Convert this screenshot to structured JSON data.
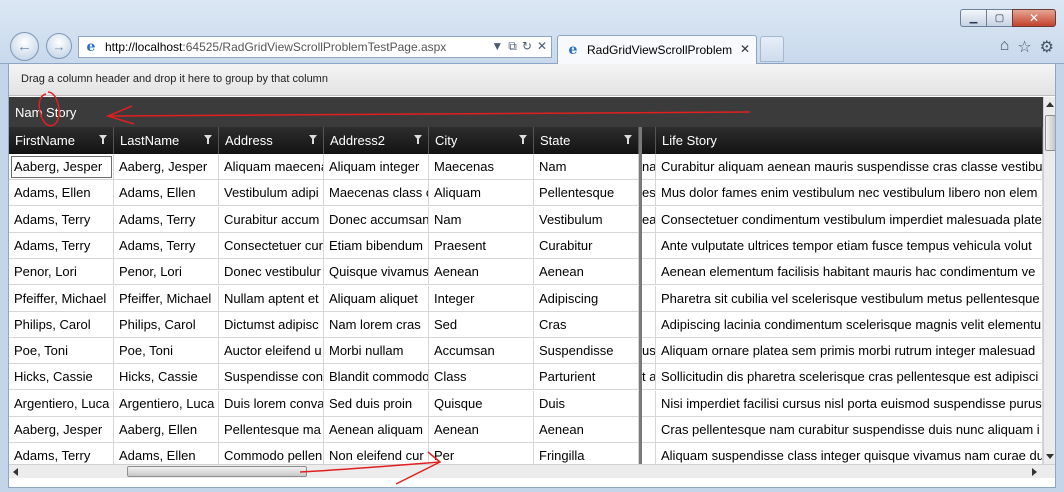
{
  "browser": {
    "url_host": "http://localhost",
    "url_rest": ":64525/RadGridViewScrollProblemTestPage.aspx",
    "tab_title": "RadGridViewScrollProblem",
    "tab_close_glyph": "✕",
    "back_glyph": "←",
    "forward_glyph": "→",
    "window_buttons": {
      "minimize": "▁",
      "maximize": "▢",
      "close": "✕"
    },
    "address_tools": {
      "dropdown": "▼",
      "compat": "⧉",
      "refresh": "↻",
      "stop": "✕"
    },
    "right_tools": {
      "home": "⌂",
      "favorites": "☆",
      "tools": "⚙"
    }
  },
  "grid": {
    "group_panel_text": "Drag a column header and drop it here to group by that column",
    "title": "Nam  Story",
    "columns": [
      {
        "key": "first",
        "label": "FirstName",
        "filter": true
      },
      {
        "key": "last",
        "label": "LastName",
        "filter": true
      },
      {
        "key": "address",
        "label": "Address",
        "filter": true
      },
      {
        "key": "address2",
        "label": "Address2",
        "filter": true
      },
      {
        "key": "city",
        "label": "City",
        "filter": true
      },
      {
        "key": "state",
        "label": "State",
        "filter": true
      },
      {
        "key": "life",
        "label": "Life Story",
        "filter": false
      }
    ],
    "rows": [
      {
        "first": "Aaberg, Jesper",
        "last": "Aaberg, Jesper",
        "address": "Aliquam maecena",
        "address2": "Aliquam integer",
        "city": "Maecenas",
        "state": "Nam",
        "hidden": "na",
        "life": "Curabitur aliquam aenean mauris suspendisse cras classe vestibulu"
      },
      {
        "first": "Adams, Ellen",
        "last": "Adams, Ellen",
        "address": "Vestibulum adipi",
        "address2": "Maecenas class c",
        "city": "Aliquam",
        "state": "Pellentesque",
        "hidden": "ese",
        "life": "Mus dolor fames enim vestibulum nec vestibulum libero non elem"
      },
      {
        "first": "Adams, Terry",
        "last": "Adams, Terry",
        "address": "Curabitur accum",
        "address2": "Donec accumsan",
        "city": "Nam",
        "state": "Vestibulum",
        "hidden": "ear",
        "life": "Consectetuer condimentum vestibulum imperdiet malesuada plate"
      },
      {
        "first": "Adams, Terry",
        "last": "Adams, Terry",
        "address": "Consectetuer cur",
        "address2": "Etiam bibendum",
        "city": "Praesent",
        "state": "Curabitur",
        "hidden": "",
        "life": "Ante vulputate ultrices tempor etiam fusce tempus vehicula volut"
      },
      {
        "first": "Penor, Lori",
        "last": "Penor, Lori",
        "address": "Donec vestibulur",
        "address2": "Quisque vivamus",
        "city": "Aenean",
        "state": "Aenean",
        "hidden": "",
        "life": "Aenean elementum facilisis habitant mauris hac condimentum ve"
      },
      {
        "first": "Pfeiffer, Michael",
        "last": "Pfeiffer, Michael",
        "address": "Nullam aptent et",
        "address2": "Aliquam aliquet",
        "city": "Integer",
        "state": "Adipiscing",
        "hidden": "",
        "life": "Pharetra sit cubilia vel scelerisque vestibulum metus pellentesque"
      },
      {
        "first": "Philips, Carol",
        "last": "Philips, Carol",
        "address": "Dictumst adipisc",
        "address2": "Nam lorem cras",
        "city": "Sed",
        "state": "Cras",
        "hidden": "",
        "life": "Adipiscing lacinia condimentum scelerisque magnis velit elementu"
      },
      {
        "first": "Poe, Toni",
        "last": "Poe, Toni",
        "address": "Auctor eleifend u",
        "address2": "Morbi nullam",
        "city": "Accumsan",
        "state": "Suspendisse",
        "hidden": "us",
        "life": "Aliquam ornare platea sem primis morbi rutrum integer malesuad"
      },
      {
        "first": "Hicks, Cassie",
        "last": "Hicks, Cassie",
        "address": "Suspendisse con",
        "address2": "Blandit commodo",
        "city": "Class",
        "state": "Parturient",
        "hidden": "t ar",
        "life": "Sollicitudin dis pharetra scelerisque cras pellentesque est adipisci"
      },
      {
        "first": "Argentiero, Luca",
        "last": "Argentiero, Luca",
        "address": "Duis lorem conva",
        "address2": "Sed duis proin",
        "city": "Quisque",
        "state": "Duis",
        "hidden": "",
        "life": "Nisi imperdiet facilisi cursus nisl porta euismod suspendisse purus"
      },
      {
        "first": "Aaberg, Jesper",
        "last": "Aaberg, Ellen",
        "address": "Pellentesque ma",
        "address2": "Aenean aliquam",
        "city": "Aenean",
        "state": "Aenean",
        "hidden": "",
        "life": "Cras pellentesque nam curabitur suspendisse duis nunc aliquam i"
      },
      {
        "first": "Adams, Terry",
        "last": "Adams, Ellen",
        "address": "Commodo pellen",
        "address2": "Non eleifend cur",
        "city": "Per",
        "state": "Fringilla",
        "hidden": "",
        "life": "Aliquam suspendisse class integer quisque vivamus nam curae du"
      }
    ]
  },
  "annotation_color": "#e02020"
}
